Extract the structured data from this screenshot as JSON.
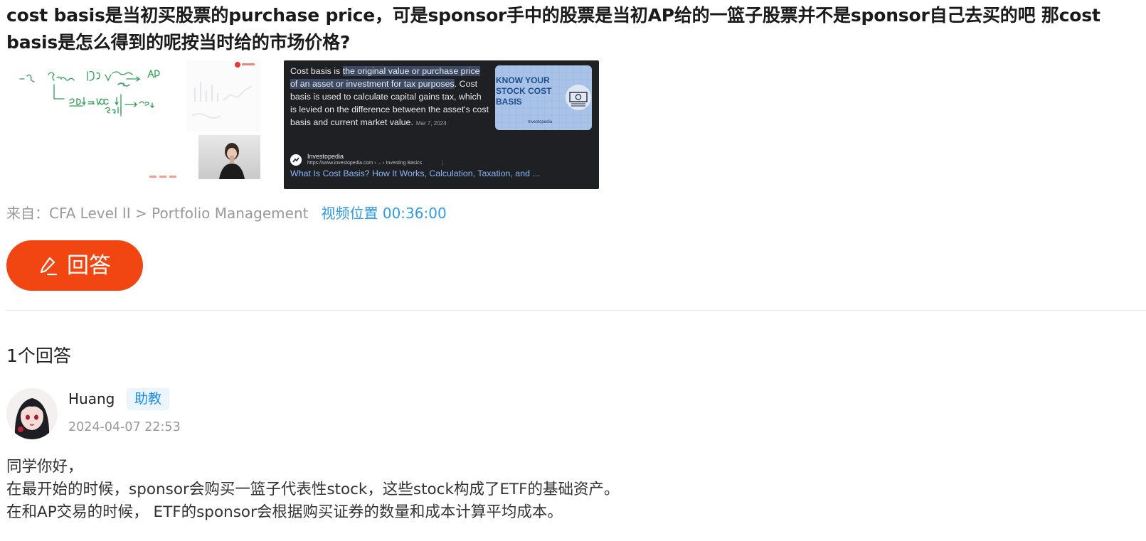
{
  "question": {
    "title": "cost basis是当初买股票的purchase price，可是sponsor手中的股票是当初AP给的一篮子股票并不是sponsor自己去买的吧 那cost basis是怎么得到的呢按当时给的市场价格?"
  },
  "attachments": {
    "lecture_screenshot": {
      "icon": "lecture-video-frame-icon"
    },
    "search_snippet": {
      "text_before": "Cost basis is ",
      "text_highlight": "the original value or purchase price of an asset or investment for tax purposes",
      "text_after": ". Cost basis is used to calculate capital gains tax, which is levied on the difference between the asset's cost basis and current market value.",
      "date": "Mar 7, 2024",
      "card_title": "KNOW YOUR STOCK COST BASIS",
      "card_brand": "Investopedia",
      "source_name": "Investopedia",
      "source_url": "https://www.investopedia.com › ... › Investing Basics",
      "more_glyph": "⋮",
      "link_text": "What Is Cost Basis? How It Works, Calculation, Taxation, and ..."
    }
  },
  "meta": {
    "from_text": "来自：CFA Level II > Portfolio Management",
    "video_position": "视频位置 00:36:00"
  },
  "answer_button": {
    "label": "回答",
    "icon": "pencil-icon",
    "background": "#f24612"
  },
  "answers": {
    "count_label": "1个回答",
    "items": [
      {
        "author": "Huang",
        "role": "助教",
        "time": "2024-04-07 22:53",
        "lines": [
          "同学你好，",
          "在最开始的时候，sponsor会购买一篮子代表性stock，这些stock构成了ETF的基础资产。",
          "在和AP交易的时候， ETF的sponsor会根据购买证券的数量和成本计算平均成本。"
        ]
      }
    ]
  },
  "colors": {
    "accent_orange": "#f24612",
    "link_blue": "#2e9be6",
    "muted_gray": "#999999"
  }
}
